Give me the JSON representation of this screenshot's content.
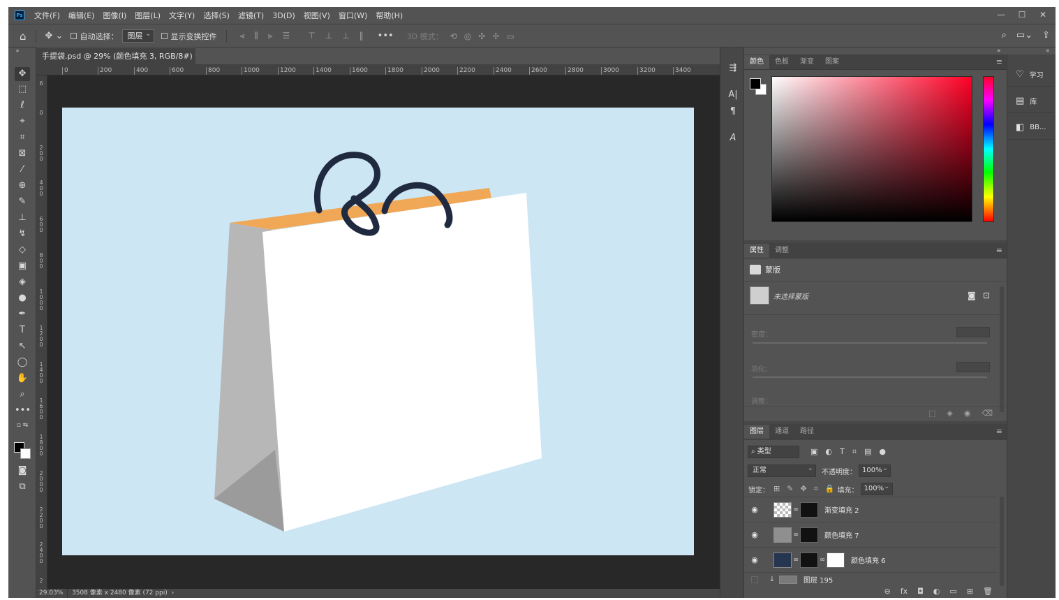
{
  "app": {
    "logo": "Ps",
    "menu": [
      "文件(F)",
      "编辑(E)",
      "图像(I)",
      "图层(L)",
      "文字(Y)",
      "选择(S)",
      "滤镜(T)",
      "3D(D)",
      "视图(V)",
      "窗口(W)",
      "帮助(H)"
    ],
    "window_controls": [
      "—",
      "☐",
      "✕"
    ]
  },
  "options": {
    "auto_select_label": "自动选择：",
    "auto_select_target": "图层",
    "show_transform_label": "显示变换控件",
    "more": "•••",
    "mode3d_label": "3D 模式："
  },
  "document": {
    "tab_title": "手提袋.psd @ 29% (颜色填充 3, RGB/8#) *",
    "close": "×",
    "zoom": "29.03%",
    "dimensions": "3508 像素 x 2480 像素 (72 ppi)",
    "status_arrow": "›"
  },
  "ruler": {
    "h_ticks": [
      "0",
      "200",
      "400",
      "600",
      "800",
      "1000",
      "1200",
      "1400",
      "1600",
      "1800",
      "2000",
      "2200",
      "2400",
      "2600",
      "2800",
      "3000",
      "3200",
      "3400"
    ],
    "v_ticks": [
      "6",
      "0",
      "2 0 0",
      "4 0 0",
      "6 0 0",
      "8 0 0",
      "1 0 0 0",
      "1 2 0 0",
      "1 4 0 0",
      "1 6 0 0",
      "1 8 0 0",
      "2 0 0 0",
      "2 2 0 0",
      "2 4 0 0",
      "2"
    ]
  },
  "colors": {
    "canvas_bg": "#cce6f4",
    "bag_front": "#ffffff",
    "bag_side": "#b7b7b7",
    "bag_side_shadow": "#9b9b9b",
    "bag_top": "#f0a856",
    "handle": "#1f2a40"
  },
  "color_panel": {
    "tabs": [
      "颜色",
      "色板",
      "渐变",
      "图案"
    ],
    "menu": "≡"
  },
  "properties_panel": {
    "tabs": [
      "属性",
      "调整"
    ],
    "menu": "≡",
    "type_label": "蒙版",
    "mask_name": "未选择蒙版",
    "density_label": "密度：",
    "feather_label": "羽化：",
    "adjust_label": "调整："
  },
  "layers_panel": {
    "tabs": [
      "图层",
      "通道",
      "路径"
    ],
    "menu": "≡",
    "filter_label": "类型",
    "blend_mode": "正常",
    "opacity_label": "不透明度：",
    "opacity_value": "100%",
    "lock_label": "锁定：",
    "fill_label": "填充：",
    "fill_value": "100%",
    "layers": [
      {
        "name": "渐变填充 2",
        "visible": "◉"
      },
      {
        "name": "颜色填充 7",
        "visible": "◉"
      },
      {
        "name": "颜色填充 6",
        "visible": "◉"
      },
      {
        "name": "图层 195",
        "visible": ""
      }
    ],
    "footer_icons": [
      "⊖",
      "fx",
      "◘",
      "◐",
      "▭",
      "⊞",
      "🗑"
    ]
  },
  "learn_dock": {
    "items": [
      {
        "icon": "lightbulb-icon",
        "label": "学习"
      },
      {
        "icon": "library-icon",
        "label": "库"
      },
      {
        "icon": "layers-comp-icon",
        "label": "BB..."
      }
    ]
  }
}
